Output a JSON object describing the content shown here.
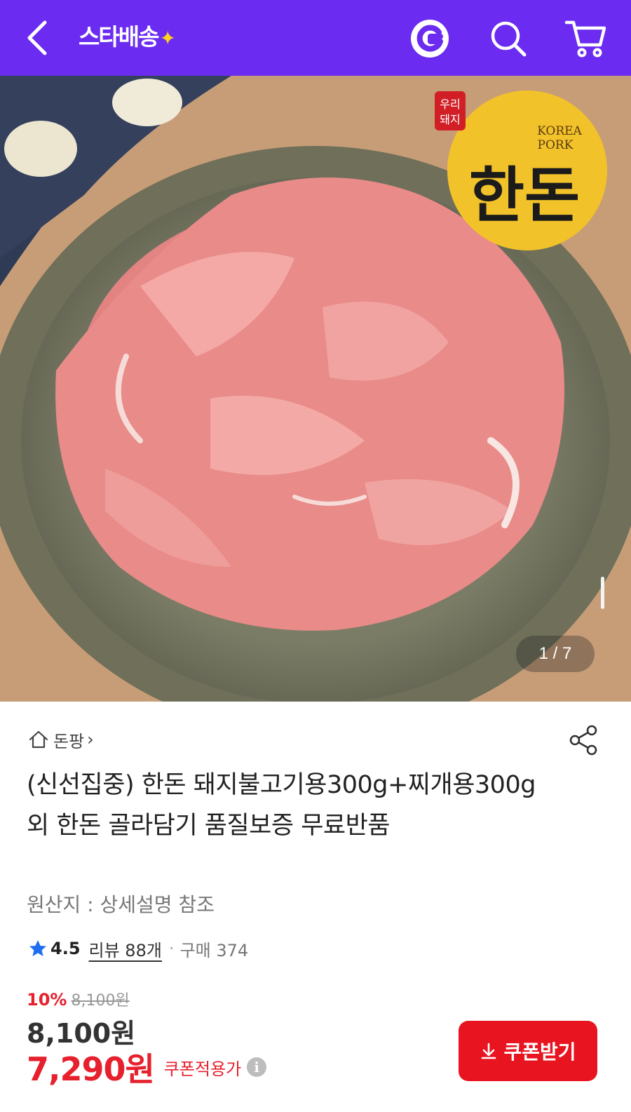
{
  "header": {
    "back_icon": "chevron-left-icon",
    "logo_text": "스타배송",
    "logo_star": "✦",
    "g_icon": "g-logo-icon",
    "search_icon": "search-icon",
    "cart_icon": "cart-icon",
    "bg_color": "#6b2bf0"
  },
  "gallery": {
    "badge_box": "우리\n돼지",
    "badge_line1": "우리",
    "badge_line2": "돼지",
    "brand_en_1": "KOREA",
    "brand_en_2": "PORK",
    "brand_ko": "한돈",
    "counter": "1 / 7"
  },
  "store": {
    "home_icon": "home-icon",
    "name": "돈팡",
    "chevron": "›",
    "share_icon": "share-icon"
  },
  "product": {
    "title": "(신선집중) 한돈 돼지불고기용300g+찌개용300g 외 한돈 골라담기 품질보증 무료반품",
    "origin": "원산지 : 상세설명 참조",
    "rating": "4.5",
    "review_text": "리뷰 88개",
    "separator": "·",
    "purchase_text": "구매 374"
  },
  "price": {
    "discount_pct": "10%",
    "original": "8,100원",
    "price": "8,100원",
    "coupon_price": "7,290원",
    "coupon_label": "쿠폰적용가",
    "info_icon": "i",
    "accent_color": "#e6212d"
  },
  "coupon_button": {
    "label": "쿠폰받기",
    "icon": "download-icon"
  }
}
